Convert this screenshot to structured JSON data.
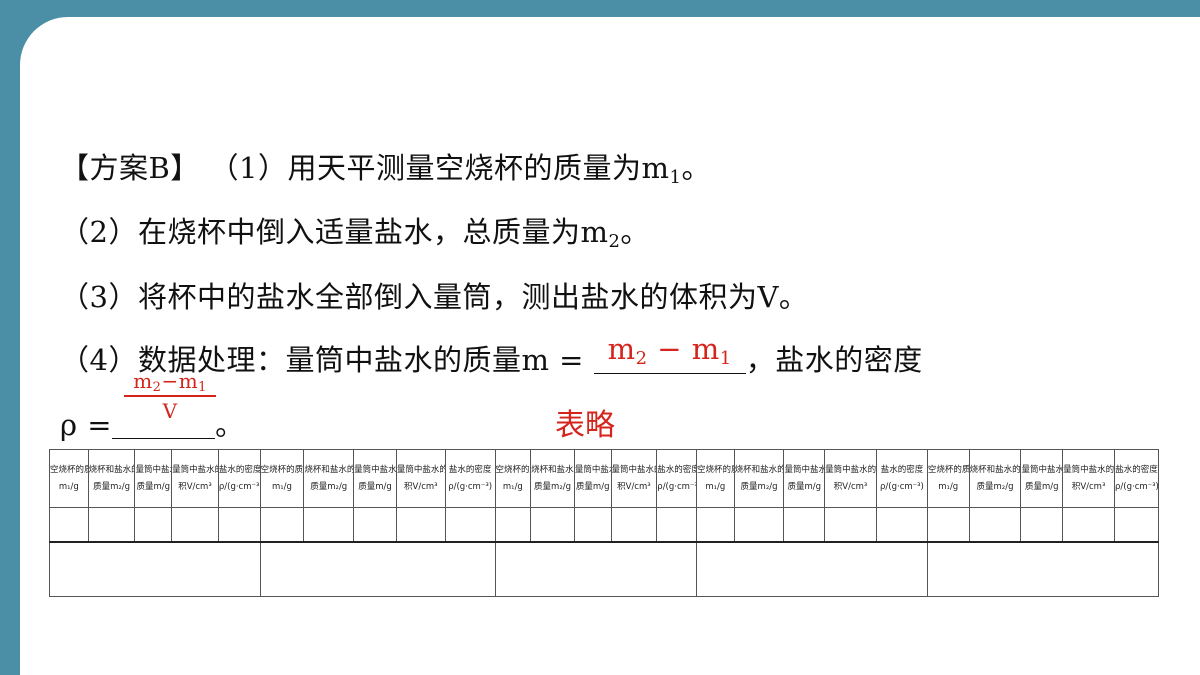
{
  "lines": {
    "l1": {
      "prefix": "【方案B】 （1）用天平测量空烧杯的质量为m",
      "sub": "1",
      "suffix": "。"
    },
    "l2": {
      "prefix": "（2）在烧杯中倒入适量盐水，总质量为m",
      "sub": "2",
      "suffix": "。"
    },
    "l3": {
      "text": "（3）将杯中的盐水全部倒入量筒，测出盐水的体积为V。"
    },
    "l4": {
      "prefix": "（4）数据处理：量筒中盐水的质量m = ",
      "answer_a": "m",
      "answer_a_sub": "2",
      "answer_op": " − m",
      "answer_b_sub": "1",
      "suffix": "，盐水的密度"
    },
    "l5": {
      "prefix": "ρ =",
      "frac_num_a": "m",
      "frac_num_a_sub": "2",
      "frac_num_op": "−m",
      "frac_num_b_sub": "1",
      "frac_den": "V",
      "suffix": "。"
    }
  },
  "note": "表略",
  "table": {
    "group_count": 5,
    "header_line1": [
      "空烧杯的质量",
      "烧杯和盐水的总",
      "量筒中盐水的",
      "量筒中盐水的体",
      "盐水的密度"
    ],
    "header_line2": [
      "m₁/g",
      "质量m₂/g",
      "质量m/g",
      "积V/cm³",
      "ρ/(g·cm⁻³)"
    ]
  },
  "colors": {
    "frame": "#4a8fa6",
    "answer": "#d4241c"
  }
}
